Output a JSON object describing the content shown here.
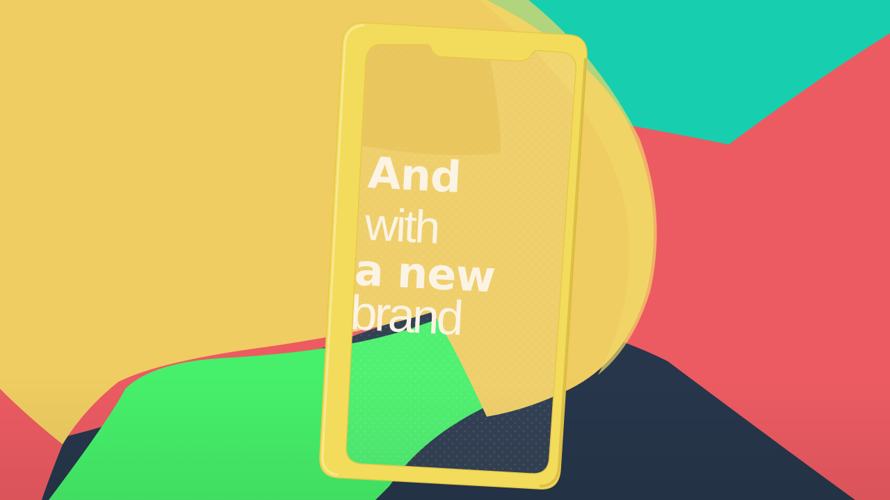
{
  "headline": {
    "line1": "And",
    "line2": "with",
    "line3": "a new",
    "line4": "brand"
  },
  "colors": {
    "yellow": "#efcd62",
    "teal": "#17cfae",
    "coral": "#ec5b62",
    "green": "#46f06a",
    "navy": "#27364b",
    "phone_frame": "#f3dc5c",
    "text": "#fbf3e4"
  }
}
